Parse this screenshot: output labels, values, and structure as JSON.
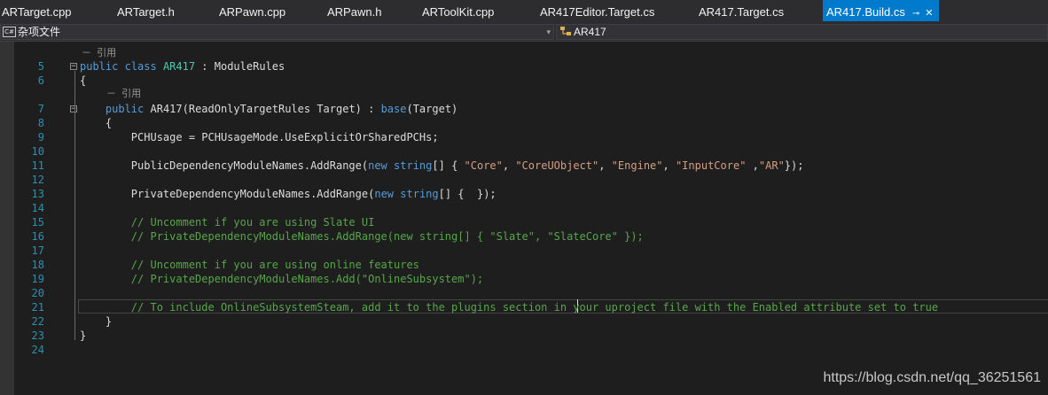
{
  "tabs": [
    {
      "label": "ARTarget.cpp"
    },
    {
      "label": "ARTarget.h"
    },
    {
      "label": "ARPawn.cpp"
    },
    {
      "label": "ARPawn.h"
    },
    {
      "label": "ARToolKit.cpp"
    },
    {
      "label": "AR417Editor.Target.cs"
    },
    {
      "label": "AR417.Target.cs"
    },
    {
      "label": "AR417.Build.cs",
      "active": true,
      "pin_glyph": "⊸",
      "close_glyph": "✕"
    }
  ],
  "nav": {
    "project_badge": "C#",
    "project_label": "杂项文件",
    "class_icon": "class-icon",
    "class_label": "AR417",
    "dropdown_glyph": "▾"
  },
  "code_lens": "引用",
  "code_lens_prefix": "－",
  "lines": [
    {
      "n": "5",
      "segs": [
        {
          "t": "public",
          "c": "kw"
        },
        {
          "t": " "
        },
        {
          "t": "class",
          "c": "kw"
        },
        {
          "t": " "
        },
        {
          "t": "AR417",
          "c": "ty"
        },
        {
          "t": " : ModuleRules"
        }
      ]
    },
    {
      "n": "6",
      "segs": [
        {
          "t": "{"
        }
      ]
    },
    {
      "n": "7",
      "segs": [
        {
          "t": "    "
        },
        {
          "t": "public",
          "c": "kw"
        },
        {
          "t": " AR417(ReadOnlyTargetRules Target) : "
        },
        {
          "t": "base",
          "c": "kw"
        },
        {
          "t": "(Target)"
        }
      ]
    },
    {
      "n": "8",
      "segs": [
        {
          "t": "    {"
        }
      ]
    },
    {
      "n": "9",
      "segs": [
        {
          "t": "        PCHUsage = PCHUsageMode.UseExplicitOrSharedPCHs;"
        }
      ]
    },
    {
      "n": "10",
      "segs": []
    },
    {
      "n": "11",
      "segs": [
        {
          "t": "        PublicDependencyModuleNames.AddRange("
        },
        {
          "t": "new",
          "c": "kw"
        },
        {
          "t": " "
        },
        {
          "t": "string",
          "c": "kw"
        },
        {
          "t": "[] { "
        },
        {
          "t": "\"Core\"",
          "c": "str"
        },
        {
          "t": ", "
        },
        {
          "t": "\"CoreUObject\"",
          "c": "str"
        },
        {
          "t": ", "
        },
        {
          "t": "\"Engine\"",
          "c": "str"
        },
        {
          "t": ", "
        },
        {
          "t": "\"InputCore\"",
          "c": "str"
        },
        {
          "t": " ,"
        },
        {
          "t": "\"AR\"",
          "c": "str"
        },
        {
          "t": "});"
        }
      ]
    },
    {
      "n": "12",
      "segs": []
    },
    {
      "n": "13",
      "segs": [
        {
          "t": "        PrivateDependencyModuleNames.AddRange("
        },
        {
          "t": "new",
          "c": "kw"
        },
        {
          "t": " "
        },
        {
          "t": "string",
          "c": "kw"
        },
        {
          "t": "[] {  });"
        }
      ]
    },
    {
      "n": "14",
      "segs": []
    },
    {
      "n": "15",
      "segs": [
        {
          "t": "        "
        },
        {
          "t": "// Uncomment if you are using Slate UI",
          "c": "cm"
        }
      ]
    },
    {
      "n": "16",
      "segs": [
        {
          "t": "        "
        },
        {
          "t": "// PrivateDependencyModuleNames.AddRange(new string[] { \"Slate\", \"SlateCore\" });",
          "c": "cm"
        }
      ]
    },
    {
      "n": "17",
      "segs": []
    },
    {
      "n": "18",
      "segs": [
        {
          "t": "        "
        },
        {
          "t": "// Uncomment if you are using online features",
          "c": "cm"
        }
      ]
    },
    {
      "n": "19",
      "segs": [
        {
          "t": "        "
        },
        {
          "t": "// PrivateDependencyModuleNames.Add(\"OnlineSubsystem\");",
          "c": "cm"
        }
      ]
    },
    {
      "n": "20",
      "segs": []
    },
    {
      "n": "21",
      "segs": [
        {
          "t": "        "
        },
        {
          "t": "// To include OnlineSubsystemSteam, add it to the plugins section in your uproject file with the Enabled attribute set to true",
          "c": "cm"
        }
      ]
    },
    {
      "n": "22",
      "segs": [
        {
          "t": "    }"
        }
      ]
    },
    {
      "n": "23",
      "segs": [
        {
          "t": "}"
        }
      ]
    },
    {
      "n": "24",
      "segs": []
    }
  ],
  "colors": {
    "keyword": "#569cd6",
    "type": "#4ec9b0",
    "string": "#d69d85",
    "comment": "#57a64a",
    "line_number": "#2b91af",
    "accent": "#007acc"
  },
  "watermark": "https://blog.csdn.net/qq_36251561"
}
